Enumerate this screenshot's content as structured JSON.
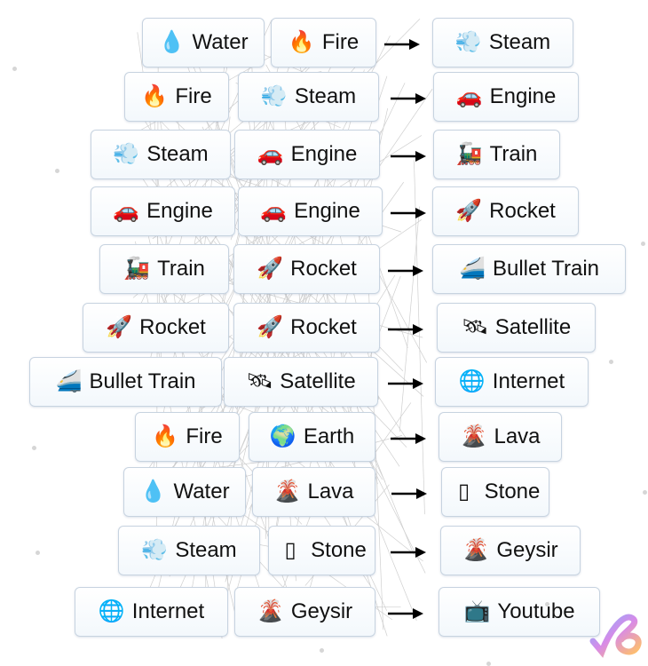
{
  "recipes": [
    {
      "a": {
        "icon": "💧",
        "icon_name": "droplet-icon",
        "label": "Water"
      },
      "b": {
        "icon": "🔥",
        "icon_name": "fire-icon",
        "label": "Fire"
      },
      "result": {
        "icon": "💨",
        "icon_name": "dash-icon",
        "label": "Steam"
      }
    },
    {
      "a": {
        "icon": "🔥",
        "icon_name": "fire-icon",
        "label": "Fire"
      },
      "b": {
        "icon": "💨",
        "icon_name": "dash-icon",
        "label": "Steam"
      },
      "result": {
        "icon": "🚗",
        "icon_name": "car-icon",
        "label": "Engine"
      }
    },
    {
      "a": {
        "icon": "💨",
        "icon_name": "dash-icon",
        "label": "Steam"
      },
      "b": {
        "icon": "🚗",
        "icon_name": "car-icon",
        "label": "Engine"
      },
      "result": {
        "icon": "🚂",
        "icon_name": "locomotive-icon",
        "label": "Train"
      }
    },
    {
      "a": {
        "icon": "🚗",
        "icon_name": "car-icon",
        "label": "Engine"
      },
      "b": {
        "icon": "🚗",
        "icon_name": "car-icon",
        "label": "Engine"
      },
      "result": {
        "icon": "🚀",
        "icon_name": "rocket-icon",
        "label": "Rocket"
      }
    },
    {
      "a": {
        "icon": "🚂",
        "icon_name": "locomotive-icon",
        "label": "Train"
      },
      "b": {
        "icon": "🚀",
        "icon_name": "rocket-icon",
        "label": "Rocket"
      },
      "result": {
        "icon": "🚄",
        "icon_name": "bullet-train-icon",
        "label": "Bullet Train"
      }
    },
    {
      "a": {
        "icon": "🚀",
        "icon_name": "rocket-icon",
        "label": "Rocket"
      },
      "b": {
        "icon": "🚀",
        "icon_name": "rocket-icon",
        "label": "Rocket"
      },
      "result": {
        "icon": "🛰",
        "icon_name": "satellite-icon",
        "label": "Satellite"
      }
    },
    {
      "a": {
        "icon": "🚄",
        "icon_name": "bullet-train-icon",
        "label": "Bullet Train"
      },
      "b": {
        "icon": "🛰",
        "icon_name": "satellite-icon",
        "label": "Satellite"
      },
      "result": {
        "icon": "🌐",
        "icon_name": "globe-icon",
        "label": "Internet"
      }
    },
    {
      "a": {
        "icon": "🔥",
        "icon_name": "fire-icon",
        "label": "Fire"
      },
      "b": {
        "icon": "🌍",
        "icon_name": "earth-icon",
        "label": "Earth"
      },
      "result": {
        "icon": "🌋",
        "icon_name": "volcano-icon",
        "label": "Lava"
      }
    },
    {
      "a": {
        "icon": "💧",
        "icon_name": "droplet-icon",
        "label": "Water"
      },
      "b": {
        "icon": "🌋",
        "icon_name": "volcano-icon",
        "label": "Lava"
      },
      "result": {
        "icon": "▯",
        "icon_name": "missing-glyph-icon",
        "label": "Stone"
      }
    },
    {
      "a": {
        "icon": "💨",
        "icon_name": "dash-icon",
        "label": "Steam"
      },
      "b": {
        "icon": "▯",
        "icon_name": "missing-glyph-icon",
        "label": "Stone"
      },
      "result": {
        "icon": "🌋",
        "icon_name": "volcano-icon",
        "label": "Geysir"
      }
    },
    {
      "a": {
        "icon": "🌐",
        "icon_name": "globe-icon",
        "label": "Internet"
      },
      "b": {
        "icon": "🌋",
        "icon_name": "volcano-icon",
        "label": "Geysir"
      },
      "result": {
        "icon": "📺",
        "icon_name": "television-icon",
        "label": "Youtube"
      }
    }
  ],
  "colors": {
    "box_border": "#c7d3e0",
    "arrow": "#000000",
    "lines": "#cfcfcf"
  }
}
